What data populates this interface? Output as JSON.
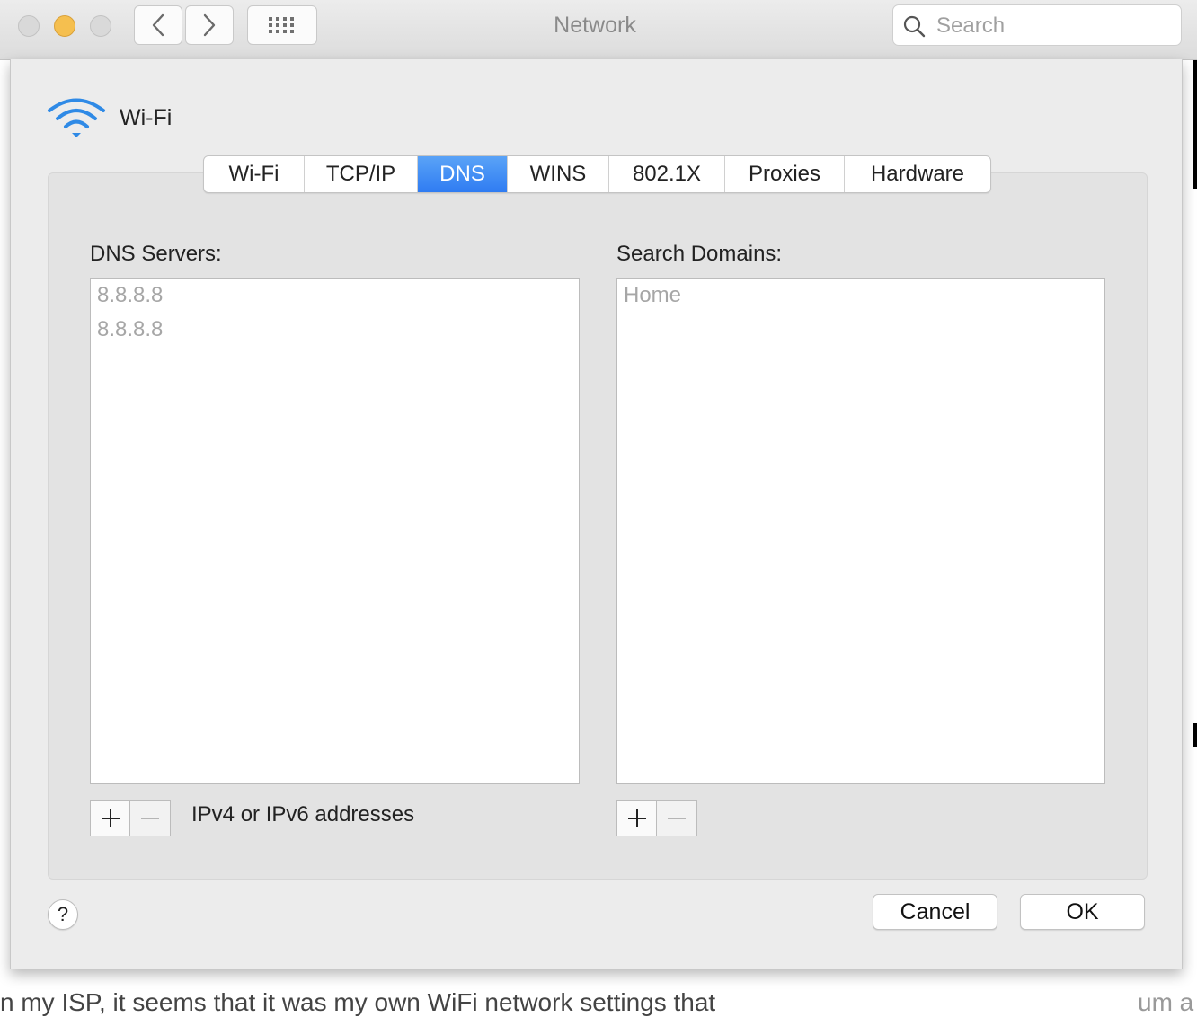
{
  "window": {
    "title": "Network",
    "search_placeholder": "Search"
  },
  "interface": {
    "name": "Wi-Fi"
  },
  "tabs": [
    {
      "label": "Wi-Fi",
      "active": false
    },
    {
      "label": "TCP/IP",
      "active": false
    },
    {
      "label": "DNS",
      "active": true
    },
    {
      "label": "WINS",
      "active": false
    },
    {
      "label": "802.1X",
      "active": false
    },
    {
      "label": "Proxies",
      "active": false
    },
    {
      "label": "Hardware",
      "active": false
    }
  ],
  "dns_servers": {
    "label": "DNS Servers:",
    "items": [
      "8.8.8.8",
      "8.8.8.8"
    ],
    "hint": "IPv4 or IPv6 addresses"
  },
  "search_domains": {
    "label": "Search Domains:",
    "items": [
      "Home"
    ]
  },
  "buttons": {
    "help": "?",
    "cancel": "Cancel",
    "ok": "OK",
    "add_symbol": "+",
    "remove_symbol": "−"
  },
  "background": {
    "text_left": "n my ISP, it seems that it was my own WiFi network settings that",
    "text_right": "um a"
  },
  "colors": {
    "accent": "#2f7cf2",
    "minimize_light": "#f5bf4f",
    "wifi_icon": "#2f8ae6"
  },
  "icons": [
    "back-chevron-icon",
    "forward-chevron-icon",
    "grid-icon",
    "search-icon",
    "wifi-icon",
    "plus-icon",
    "minus-icon"
  ]
}
